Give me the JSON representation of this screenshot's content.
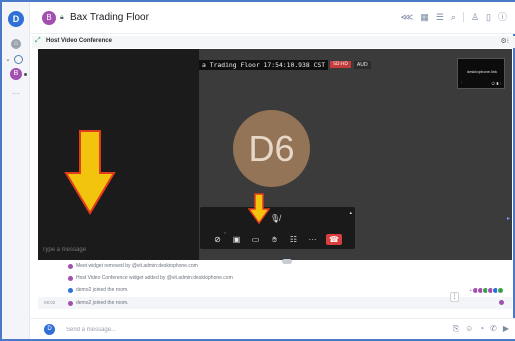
{
  "user": {
    "avatar_letter": "D"
  },
  "rail": {
    "home_icon": "home-icon",
    "space_letter": "B",
    "more_icon": "ellipsis-icon"
  },
  "header": {
    "room_avatar_letter": "B",
    "room_name": "Bax Trading Floor",
    "icons": [
      "share-icon",
      "grid-icon",
      "list-icon",
      "search-icon",
      "people-icon",
      "files-icon",
      "info-icon"
    ]
  },
  "widget": {
    "title": "Host Video Conference",
    "menu_icon": "menu-icon"
  },
  "video": {
    "banner_text": "a Trading Floor 17:54:10.938 CST",
    "banner_resolution": "SD:HD",
    "banner_audio": "AUD",
    "thumb_label": "desktophone.link",
    "participant_initials": "D6",
    "chat_placeholder": "Type a message"
  },
  "timeline": {
    "events": [
      {
        "text": "Meet widget removed by @vit.admin:desktophone.com",
        "avatar": "purple"
      },
      {
        "text": "Host Video Conference widget added by @vit.admin:desktophone.com",
        "avatar": "purple"
      },
      {
        "text": "demo2 joined the room.",
        "avatar": "blue"
      },
      {
        "text": "demo2 joined the room.",
        "avatar": "purple"
      }
    ],
    "last_event_time": "09:02",
    "receipts_more": "+",
    "receipt_colors": [
      "#a34fb0",
      "#a34fb0",
      "#3aa14b",
      "#a34fb0",
      "#2f6fd6",
      "#3aa14b"
    ]
  },
  "composer": {
    "avatar_letter": "D",
    "placeholder": "Send a message...",
    "icons": [
      "attach-icon",
      "emoji-icon",
      "sticker-icon",
      "call-icon",
      "video-icon"
    ]
  },
  "colors": {
    "accent": "#2f6fd6",
    "space_purple": "#a34fb0",
    "hangup_red": "#d93f3f",
    "avatar_tan": "#937456",
    "arrow_fill": "#f2c40d",
    "arrow_outline": "#e23a1c"
  }
}
